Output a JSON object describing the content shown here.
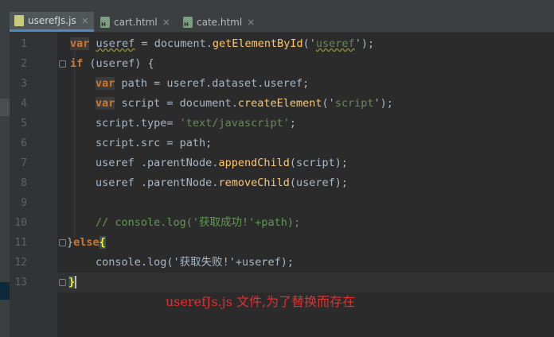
{
  "tabs": [
    {
      "label": "userefJs.js",
      "icon": "js-file-icon",
      "active": true
    },
    {
      "label": "cart.html",
      "icon": "html-file-icon",
      "active": false
    },
    {
      "label": "cate.html",
      "icon": "html-file-icon",
      "active": false
    }
  ],
  "close_glyph": "×",
  "file_icon_letter": "H",
  "line_numbers": [
    "1",
    "2",
    "3",
    "4",
    "5",
    "6",
    "7",
    "8",
    "9",
    "10",
    "11",
    "12",
    "13"
  ],
  "code": {
    "l1": {
      "kw": "var",
      "name": "useref",
      "eq": " = document.",
      "fn": "getElementById",
      "open": "('",
      "arg": "useref",
      "close": "');"
    },
    "l2": {
      "kw": "if",
      "rest": " (useref) {"
    },
    "l3": {
      "kw": "var",
      "rest": " path = useref.dataset.useref;"
    },
    "l4": {
      "kw": "var",
      "rest1": " script = document.",
      "fn": "createElement",
      "rest2": "('",
      "str": "script",
      "rest3": "');"
    },
    "l5": {
      "pre": "script.type= ",
      "str": "'text/javascript'",
      "post": ";"
    },
    "l6": {
      "text": "script.src = path;"
    },
    "l7": {
      "pre": "useref .parentNode.",
      "fn": "appendChild",
      "post": "(script);"
    },
    "l8": {
      "pre": "useref .parentNode.",
      "fn": "removeChild",
      "post": "(useref);"
    },
    "l10": {
      "comment": "// console.log('获取成功!'+path);"
    },
    "l11": {
      "brace": "}",
      "kw": "else",
      "open": "{"
    },
    "l12": {
      "text": "console.log('获取失败!'+useref);"
    },
    "l13": {
      "brace": "}"
    }
  },
  "annotation": "userefJs.js 文件,为了替换而存在",
  "colors": {
    "background": "#2b2b2b",
    "keyword": "#cc7832",
    "function": "#ffc66d",
    "string": "#6a8759",
    "comment": "#629755",
    "annotation": "#e03030",
    "tab_accent": "#4a88c7"
  }
}
